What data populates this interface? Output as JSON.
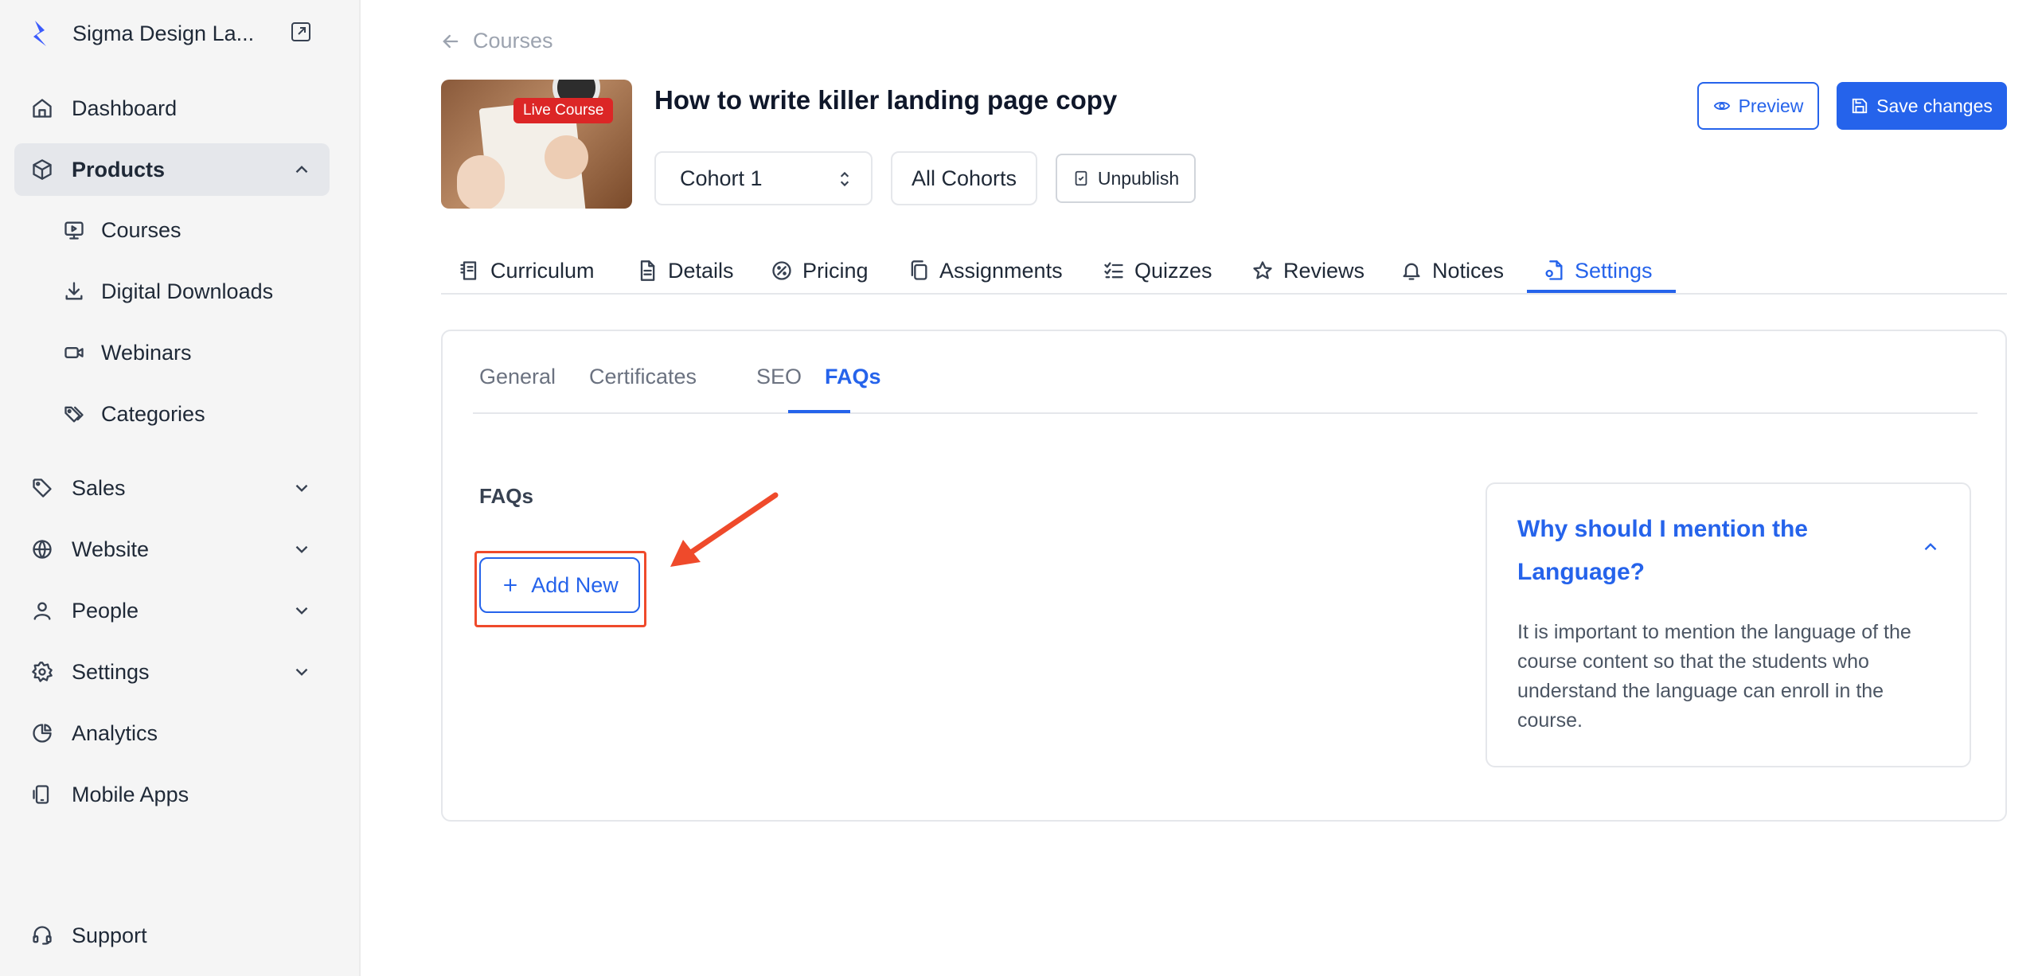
{
  "sidebar": {
    "brand": "Sigma Design La...",
    "items": [
      {
        "label": "Dashboard",
        "icon": "home-icon"
      },
      {
        "label": "Products",
        "icon": "box-icon"
      },
      {
        "label": "Sales",
        "icon": "tag-icon"
      },
      {
        "label": "Website",
        "icon": "globe-icon"
      },
      {
        "label": "People",
        "icon": "user-icon"
      },
      {
        "label": "Settings",
        "icon": "gear-icon"
      },
      {
        "label": "Analytics",
        "icon": "pie-chart-icon"
      },
      {
        "label": "Mobile Apps",
        "icon": "mobile-icon"
      }
    ],
    "products_sub": [
      {
        "label": "Courses",
        "icon": "monitor-play-icon"
      },
      {
        "label": "Digital Downloads",
        "icon": "download-icon"
      },
      {
        "label": "Webinars",
        "icon": "video-icon"
      },
      {
        "label": "Categories",
        "icon": "tags-icon"
      }
    ],
    "support": "Support"
  },
  "header": {
    "back_label": "Courses",
    "badge": "Live Course",
    "title": "How to write killer landing page copy",
    "cohort": "Cohort 1",
    "all_cohorts": "All Cohorts",
    "unpublish": "Unpublish",
    "preview": "Preview",
    "save": "Save changes"
  },
  "tabs": [
    {
      "label": "Curriculum",
      "icon": "curriculum-icon"
    },
    {
      "label": "Details",
      "icon": "document-icon"
    },
    {
      "label": "Pricing",
      "icon": "pricing-icon"
    },
    {
      "label": "Assignments",
      "icon": "copy-icon"
    },
    {
      "label": "Quizzes",
      "icon": "checklist-icon"
    },
    {
      "label": "Reviews",
      "icon": "star-icon"
    },
    {
      "label": "Notices",
      "icon": "bell-icon"
    },
    {
      "label": "Settings",
      "icon": "file-settings-icon"
    }
  ],
  "active_tab": "Settings",
  "subtabs": [
    "General",
    "Certificates",
    "SEO",
    "FAQs"
  ],
  "active_subtab": "FAQs",
  "faqs": {
    "heading": "FAQs",
    "add_new": "Add New",
    "item": {
      "question": "Why should I mention the Language?",
      "answer": "It is important to mention the language of the course content so that the students who understand the language can enroll in the course."
    }
  },
  "colors": {
    "accent": "#2563eb",
    "highlight": "#ef4a2b",
    "badge": "#dc2626"
  }
}
